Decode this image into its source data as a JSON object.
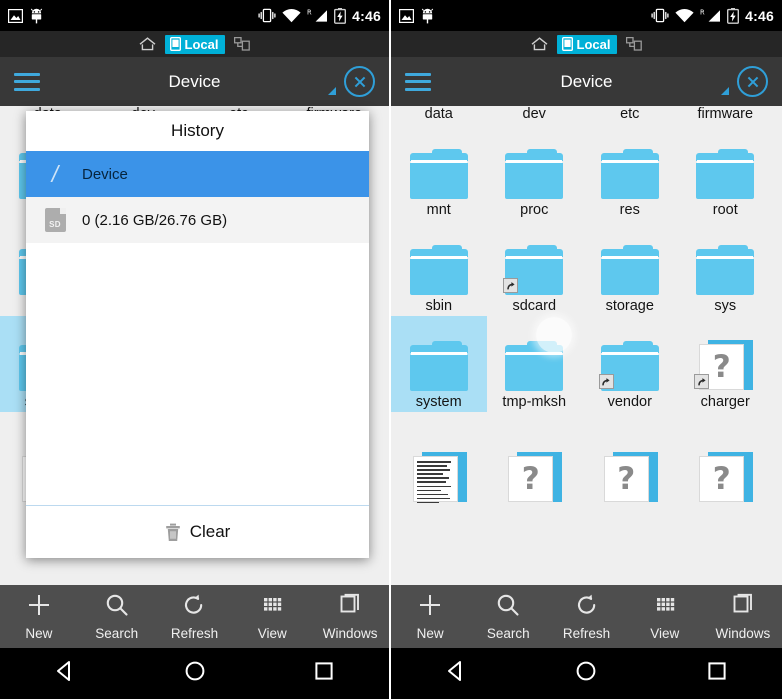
{
  "status_bar": {
    "time": "4:46",
    "icons_left": [
      "screenshot-icon",
      "android-robot-icon"
    ],
    "icons_right": [
      "vibrate-icon",
      "wifi-icon",
      "signal-roaming-icon",
      "battery-charging-icon"
    ]
  },
  "tab_bar": {
    "home_icon": "home-icon",
    "local_tab": "Local",
    "network_icon": "network-devices-icon"
  },
  "action_bar": {
    "menu_icon": "hamburger-menu-icon",
    "title": "Device",
    "close_icon": "close-circle-icon"
  },
  "dialog": {
    "title": "History",
    "rows": [
      {
        "icon": "root-slash-icon",
        "label": "Device",
        "selected": true
      },
      {
        "icon": "sd-card-icon",
        "label": "0 (2.16 GB/26.76 GB)",
        "selected": false
      }
    ],
    "clear_label": "Clear",
    "clear_icon": "trash-icon"
  },
  "toolbar": {
    "items": [
      {
        "label": "New",
        "icon": "plus-icon"
      },
      {
        "label": "Search",
        "icon": "search-icon"
      },
      {
        "label": "Refresh",
        "icon": "refresh-icon"
      },
      {
        "label": "View",
        "icon": "grid-view-icon"
      },
      {
        "label": "Windows",
        "icon": "windows-stack-icon"
      }
    ]
  },
  "nav_bar": {
    "items": [
      {
        "icon": "back-triangle-icon"
      },
      {
        "icon": "home-circle-icon"
      },
      {
        "icon": "recents-square-icon"
      }
    ]
  },
  "file_grid": {
    "rows_clipped_top": [
      "data",
      "dev",
      "etc",
      "firmware"
    ],
    "items": [
      {
        "label": "data",
        "type": "folder",
        "link": false,
        "selected": false,
        "clipped": true
      },
      {
        "label": "dev",
        "type": "folder",
        "link": false,
        "selected": false,
        "clipped": true
      },
      {
        "label": "etc",
        "type": "folder",
        "link": false,
        "selected": false,
        "clipped": true
      },
      {
        "label": "firmware",
        "type": "folder",
        "link": false,
        "selected": false,
        "clipped": true
      },
      {
        "label": "mnt",
        "type": "folder",
        "link": false,
        "selected": false
      },
      {
        "label": "proc",
        "type": "folder",
        "link": false,
        "selected": false
      },
      {
        "label": "res",
        "type": "folder",
        "link": false,
        "selected": false
      },
      {
        "label": "root",
        "type": "folder",
        "link": false,
        "selected": false
      },
      {
        "label": "sbin",
        "type": "folder",
        "link": false,
        "selected": false
      },
      {
        "label": "sdcard",
        "type": "folder",
        "link": true,
        "selected": false
      },
      {
        "label": "storage",
        "type": "folder",
        "link": false,
        "selected": false
      },
      {
        "label": "sys",
        "type": "folder",
        "link": false,
        "selected": false
      },
      {
        "label": "system",
        "type": "folder",
        "link": false,
        "selected": true
      },
      {
        "label": "tmp-mksh",
        "type": "folder",
        "link": false,
        "selected": false
      },
      {
        "label": "vendor",
        "type": "folder",
        "link": true,
        "selected": false
      },
      {
        "label": "charger",
        "type": "unknown",
        "link": true,
        "selected": false
      },
      {
        "label": "",
        "type": "text",
        "link": false,
        "selected": false
      },
      {
        "label": "",
        "type": "unknown",
        "link": false,
        "selected": false
      },
      {
        "label": "",
        "type": "unknown",
        "link": false,
        "selected": false
      },
      {
        "label": "",
        "type": "unknown",
        "link": false,
        "selected": false
      }
    ]
  },
  "left_panel_behind": {
    "visible_labels": [
      "sbin",
      "sdcard",
      "storage",
      "sys"
    ]
  },
  "colors": {
    "accent_blue": "#5ec8ee",
    "selection_blue": "#aadff5",
    "dialog_active": "#3b93e8",
    "tab_cyan": "#00b0d7",
    "action_bar": "#383838",
    "toolbar": "#4e4e4e",
    "page_bg": "#efefef"
  }
}
